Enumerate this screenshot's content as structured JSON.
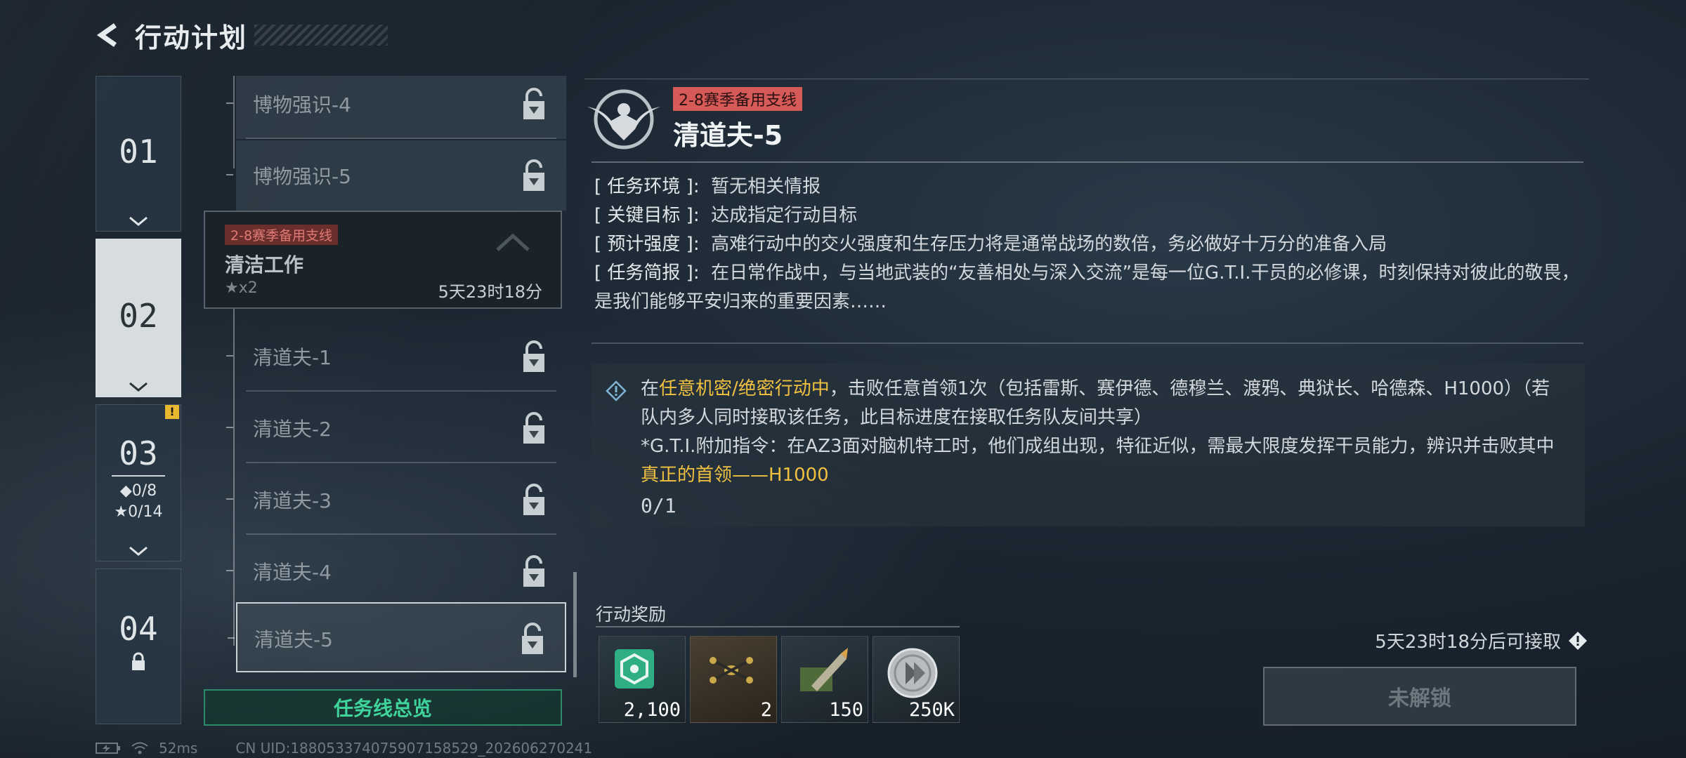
{
  "header": {
    "title": "行动计划"
  },
  "chapters": [
    {
      "num": "01"
    },
    {
      "num": "02"
    },
    {
      "num": "03",
      "diamond": "◆0/8",
      "star": "★0/14",
      "badge": "!"
    },
    {
      "num": "04"
    }
  ],
  "missions_top": [
    {
      "label": "博物强识-4"
    },
    {
      "label": "博物强识-5"
    }
  ],
  "chain": {
    "tag": "2-8赛季备用支线",
    "name": "清洁工作",
    "stars": "★x2",
    "time": "5天23时18分"
  },
  "missions": [
    {
      "label": "清道夫-1"
    },
    {
      "label": "清道夫-2"
    },
    {
      "label": "清道夫-3"
    },
    {
      "label": "清道夫-4"
    },
    {
      "label": "清道夫-5"
    }
  ],
  "overview_btn": "任务线总览",
  "detail": {
    "tag": "2-8赛季备用支线",
    "title": "清道夫-5",
    "env_k": "[ 任务环境 ]:",
    "env_v": "暂无相关情报",
    "goal_k": "[ 关键目标 ]:",
    "goal_v": "达成指定行动目标",
    "intensity_k": "[ 预计强度 ]:",
    "intensity_v": "高难行动中的交火强度和生存压力将是通常战场的数倍，务必做好十万分的准备入局",
    "brief_k": "[ 任务简报 ]:",
    "brief_v": "在日常作战中，与当地武装的“友善相处与深入交流”是每一位G.T.I.干员的必修课，时刻保持对彼此的敬畏，是我们能够平安归来的重要因素……",
    "obj_pre": "在",
    "obj_hl1": "任意机密/绝密行动中",
    "obj_mid": "，击败任意首领1次（包括雷斯、赛伊德、德穆兰、渡鸦、典狱长、哈德森、H1000）（若队内多人同时接取该任务，此目标进度在接取任务队友间共享）",
    "obj_note": "*G.T.I.附加指令：在AZ3面对脑机特工时，他们成组出现，特征近似，需最大限度发挥干员能力，辨识并击败其中",
    "obj_hl2": "真正的首领——H1000",
    "progress": "0/1"
  },
  "rewards": {
    "title": "行动奖励",
    "items": [
      {
        "icon": "badge-icon",
        "count": "2,100"
      },
      {
        "icon": "drone-icon",
        "count": "2"
      },
      {
        "icon": "ammo-icon",
        "count": "150"
      },
      {
        "icon": "coin-icon",
        "count": "250K"
      }
    ]
  },
  "availability": "5天23时18分后可接取",
  "unlock_btn": "未解锁",
  "status": {
    "ping": "52ms",
    "uid": "CN UID:18805337407590715852​9_202606270241"
  },
  "colors": {
    "accent_green": "#3fd49b",
    "tag_red": "#d65a57",
    "highlight": "#f0c040"
  }
}
